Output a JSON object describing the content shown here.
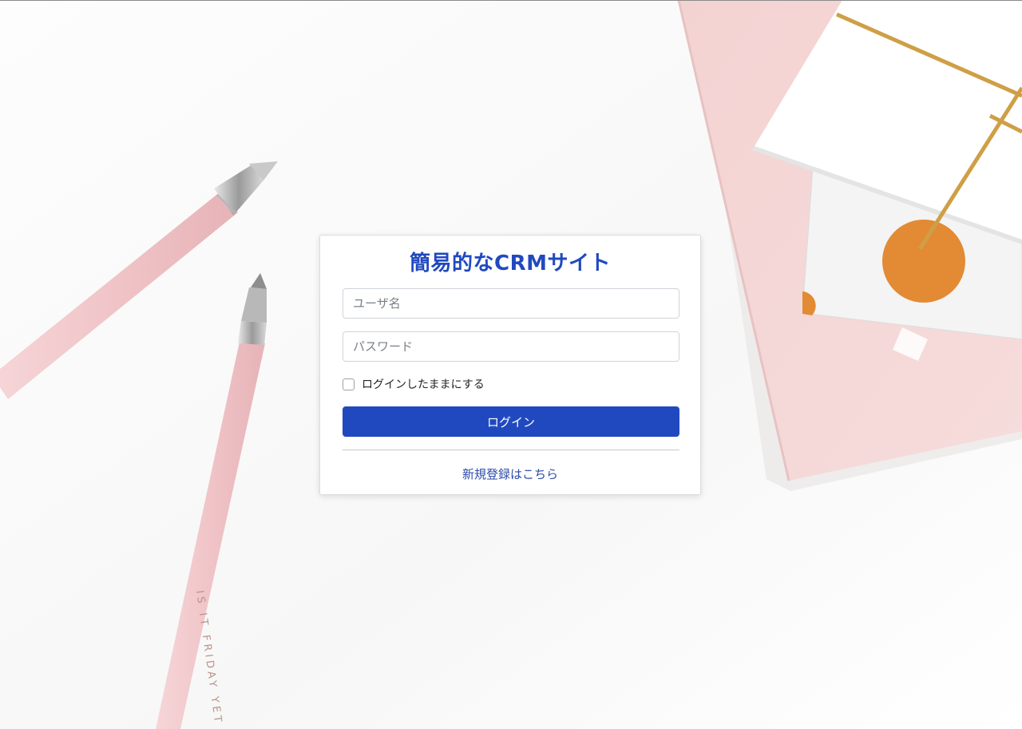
{
  "login": {
    "title": "簡易的なCRMサイト",
    "username_placeholder": "ユーザ名",
    "password_placeholder": "パスワード",
    "remember_label": "ログインしたままにする",
    "remember_checked": false,
    "submit_label": "ログイン",
    "register_link": "新規登録はこちら"
  },
  "background": {
    "pen_text": "IS IT FRIDAY YET"
  },
  "colors": {
    "accent": "#2149bf",
    "link": "#2d4aa8",
    "pen_pink": "#f2c9cb",
    "notebook_pink": "#f5d8d8",
    "gold_line": "#cf9f46",
    "orange_circle": "#e38a34"
  }
}
